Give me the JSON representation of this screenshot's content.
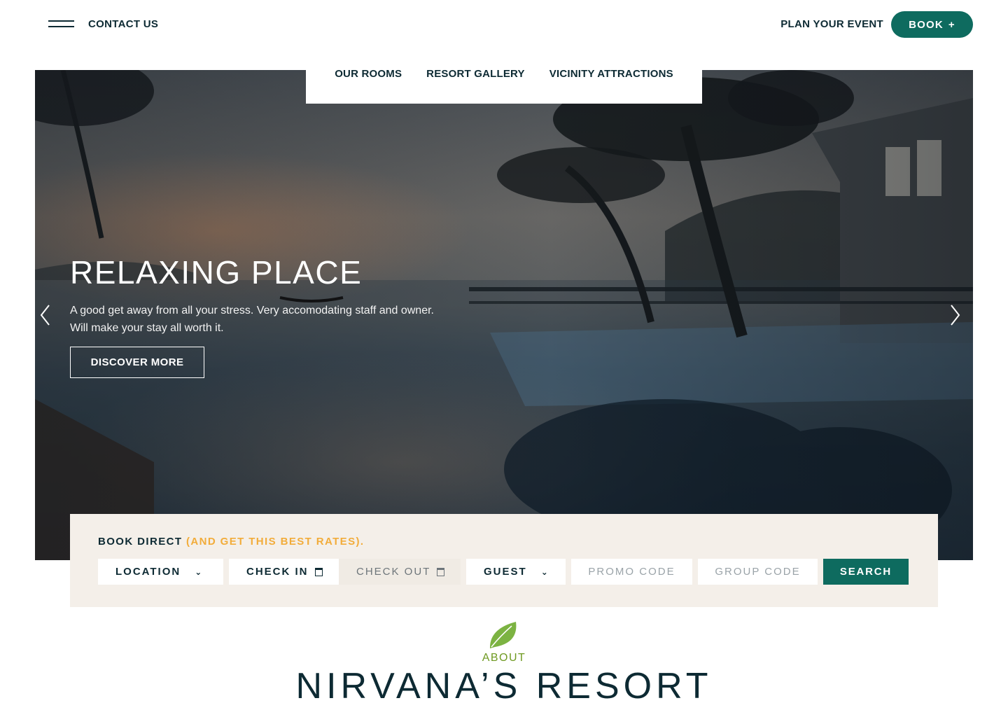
{
  "header": {
    "contact": "CONTACT US",
    "plan_event": "PLAN YOUR EVENT",
    "book": "BOOK",
    "book_icon": "+"
  },
  "subnav": [
    "OUR ROOMS",
    "RESORT GALLERY",
    "VICINITY ATTRACTIONS"
  ],
  "hero": {
    "title": "RELAXING PLACE",
    "description_line1": "A good get away from all your stress. Very accomodating staff and owner.",
    "description_line2": "Will make your stay all worth it.",
    "cta": "DISCOVER MORE"
  },
  "booking": {
    "title": "BOOK DIRECT",
    "highlight": "(AND GET THIS BEST RATES)",
    "suffix": ".",
    "location": "LOCATION",
    "check_in": "CHECK IN",
    "check_out": "CHECK OUT",
    "guest": "GUEST",
    "promo_placeholder": "PROMO CODE",
    "group_placeholder": "GROUP CODE",
    "search": "SEARCH",
    "chevron": "⌄"
  },
  "about": {
    "label": "ABOUT",
    "title": "NIRVANA’S RESORT"
  },
  "colors": {
    "accent": "#0e6b5f",
    "highlight": "#f2ac3a",
    "about_label": "#6f9a22",
    "booking_bg": "#f4efe9"
  },
  "icons": [
    "hamburger-icon",
    "plus-icon",
    "chevron-left-icon",
    "chevron-right-icon",
    "calendar-icon",
    "chevron-down-icon",
    "leaf-icon"
  ]
}
